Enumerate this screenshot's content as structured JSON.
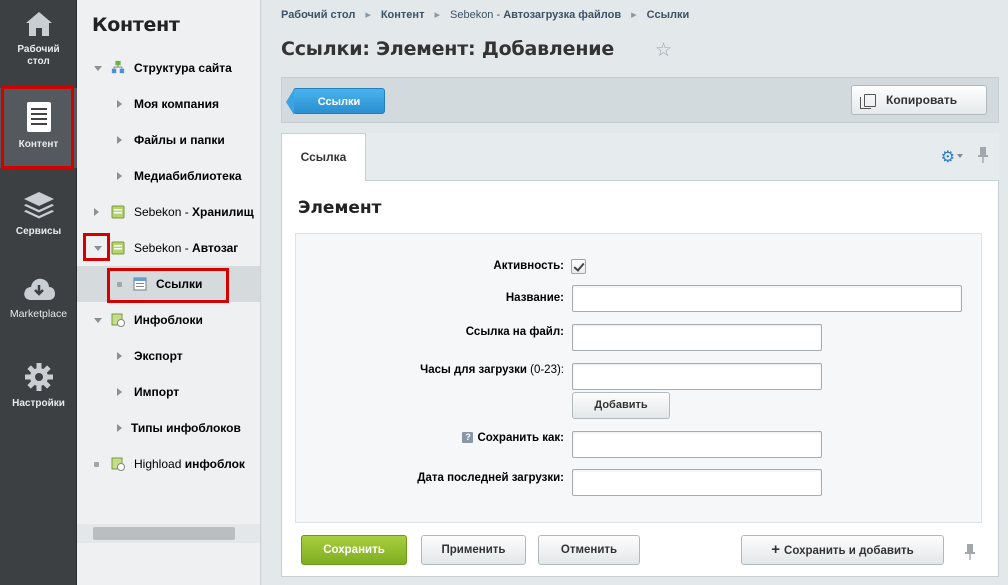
{
  "leftnav": {
    "items": [
      {
        "label_line1": "Рабочий",
        "label_line2": "стол",
        "icon": "home-icon"
      },
      {
        "label_line1": "Контент",
        "label_line2": "",
        "icon": "document-icon"
      },
      {
        "label_line1": "Сервисы",
        "label_line2": "",
        "icon": "layers-icon"
      },
      {
        "label_line1": "Marketplace",
        "label_line2": "",
        "icon": "cloud-download-icon"
      },
      {
        "label_line1": "Настройки",
        "label_line2": "",
        "icon": "gear-icon"
      }
    ]
  },
  "tree": {
    "title": "Контент",
    "items": [
      {
        "label": "Структура сайта",
        "light": ""
      },
      {
        "label": "Моя компания",
        "light": ""
      },
      {
        "label": "Файлы и папки",
        "light": ""
      },
      {
        "label": "Медиабиблиотека",
        "light": ""
      },
      {
        "label": "Хранилищ",
        "light": "Sebekon - "
      },
      {
        "label": "Автозаг",
        "light": "Sebekon - "
      },
      {
        "label": "Ссылки",
        "light": ""
      },
      {
        "label": "Инфоблоки",
        "light": ""
      },
      {
        "label": "Экспорт",
        "light": ""
      },
      {
        "label": "Импорт",
        "light": ""
      },
      {
        "label": "Типы инфоблоков",
        "light": ""
      },
      {
        "label": "инфоблок",
        "light": "Highload "
      }
    ]
  },
  "breadcrumb": {
    "items": [
      "Рабочий стол",
      "Контент",
      "Sebekon - ",
      "Автозагрузка файлов",
      "Ссылки"
    ]
  },
  "page": {
    "title": "Ссылки: Элемент: Добавление"
  },
  "toolbar": {
    "back_label": "Ссылки",
    "copy_label": "Копировать"
  },
  "tabs": [
    {
      "label": "Ссылка"
    }
  ],
  "form": {
    "section_title": "Элемент",
    "active_label": "Активность:",
    "name_label": "Название:",
    "file_link_label": "Ссылка на файл:",
    "hours_label": "Часы для загрузки",
    "hours_hint": " (0-23):",
    "add_label": "Добавить",
    "save_as_label": "Сохранить как:",
    "last_load_label": "Дата последней загрузки:",
    "active_checked": true
  },
  "buttons": {
    "save": "Сохранить",
    "apply": "Применить",
    "cancel": "Отменить",
    "save_add": "Сохранить и добавить"
  }
}
